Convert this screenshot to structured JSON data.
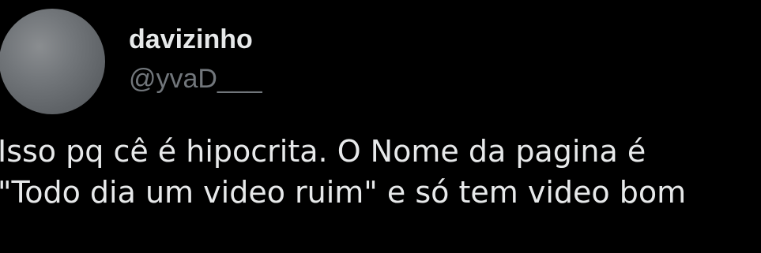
{
  "author": {
    "display_name": "davizinho",
    "handle": "@yvaD___"
  },
  "tweet": {
    "lines": [
      "Isso pq cê é hipocrita. O Nome da pagina é",
      "\"Todo dia um video ruim\" e só tem video bom"
    ]
  },
  "colors": {
    "background": "#000000",
    "primary_text": "#e7e9ea",
    "secondary_text": "#71767b"
  }
}
